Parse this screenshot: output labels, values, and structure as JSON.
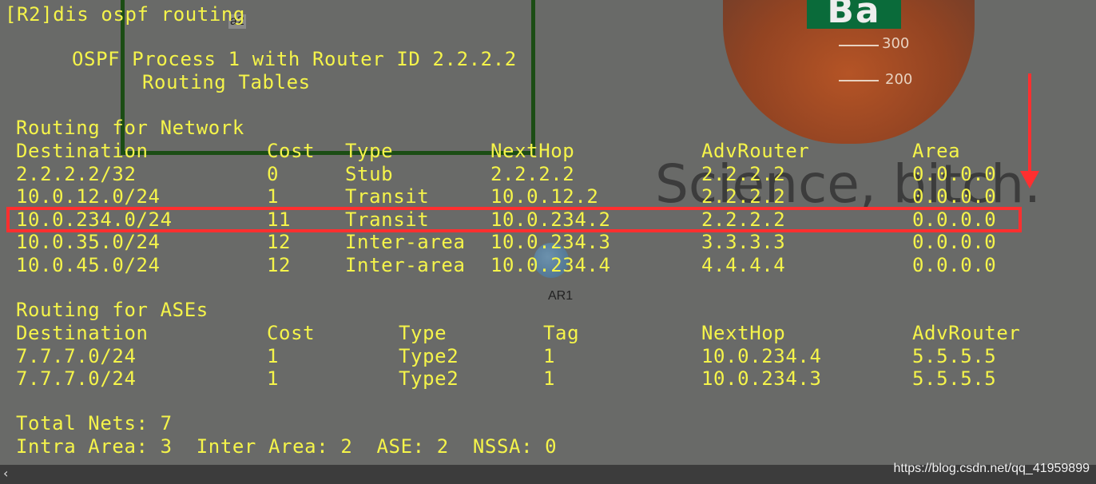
{
  "prompt": "[R2]dis ospf routing",
  "process_header": "OSPF Process 1 with Router ID 2.2.2.2",
  "tables_header": "Routing Tables",
  "network_section": {
    "title": "Routing for Network",
    "columns": [
      "Destination",
      "Cost",
      "Type",
      "NextHop",
      "AdvRouter",
      "Area"
    ],
    "rows": [
      [
        "2.2.2.2/32",
        "0",
        "Stub",
        "2.2.2.2",
        "2.2.2.2",
        "0.0.0.0"
      ],
      [
        "10.0.12.0/24",
        "1",
        "Transit",
        "10.0.12.2",
        "2.2.2.2",
        "0.0.0.0"
      ],
      [
        "10.0.234.0/24",
        "11",
        "Transit",
        "10.0.234.2",
        "2.2.2.2",
        "0.0.0.0"
      ],
      [
        "10.0.35.0/24",
        "12",
        "Inter-area",
        "10.0.234.3",
        "3.3.3.3",
        "0.0.0.0"
      ],
      [
        "10.0.45.0/24",
        "12",
        "Inter-area",
        "10.0.234.4",
        "4.4.4.4",
        "0.0.0.0"
      ]
    ]
  },
  "ase_section": {
    "title": "Routing for ASEs",
    "columns": [
      "Destination",
      "Cost",
      "Type",
      "Tag",
      "NextHop",
      "AdvRouter"
    ],
    "rows": [
      [
        "7.7.7.0/24",
        "1",
        "Type2",
        "1",
        "10.0.234.4",
        "5.5.5.5"
      ],
      [
        "7.7.7.0/24",
        "1",
        "Type2",
        "1",
        "10.0.234.3",
        "5.5.5.5"
      ]
    ]
  },
  "totals": {
    "line1": "Total Nets: 7",
    "line2": "Intra Area: 3  Inter Area: 2  ASE: 2  NSSA: 0"
  },
  "topology_labels": {
    "a2": "a2",
    "ar1": "AR1"
  },
  "wallpaper": {
    "logo": "Ba",
    "mark_300": "300",
    "mark_200": "200",
    "slogan": "Science, bitch."
  },
  "watermark": "https://blog.csdn.net/qq_41959899",
  "colors": {
    "terminal_text": "#f5f44a",
    "highlight": "#ff2f2f"
  },
  "icons": {
    "scroll_left": "chevron-left-icon"
  }
}
